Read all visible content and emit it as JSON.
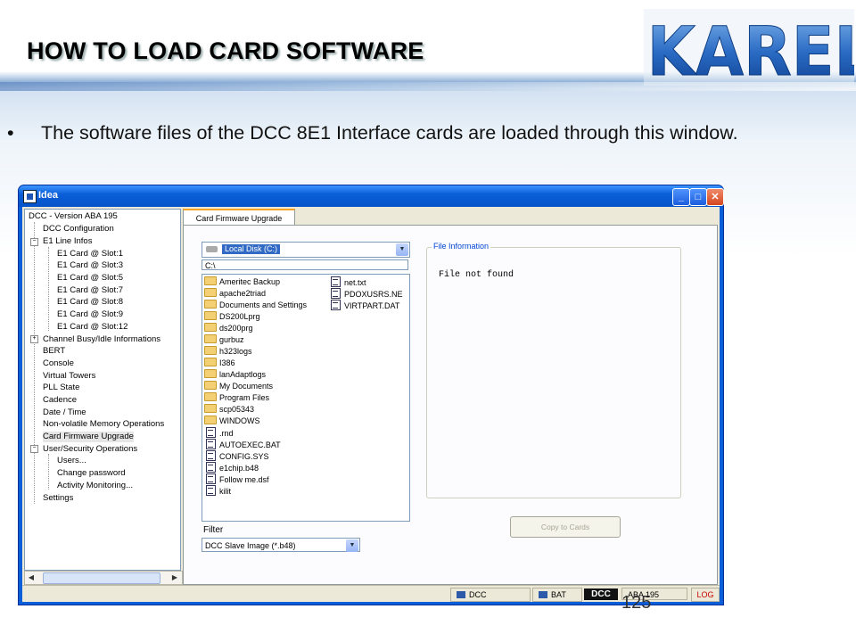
{
  "slide": {
    "title": "HOW TO LOAD CARD SOFTWARE",
    "logo_text": "KAREL",
    "bullet_marker": "•",
    "bullet": "The software files of the DCC 8E1 Interface cards are loaded through this window.",
    "page_number": "125"
  },
  "window": {
    "title": "Idea",
    "minimize": "_",
    "maximize": "□",
    "close": "✕",
    "tree": {
      "root": "DCC - Version ABA 195",
      "items": [
        "DCC Configuration",
        "E1 Line Infos",
        "E1 Card @ Slot:1",
        "E1 Card @ Slot:3",
        "E1 Card @ Slot:5",
        "E1 Card @ Slot:7",
        "E1 Card @ Slot:8",
        "E1 Card @ Slot:9",
        "E1 Card @ Slot:12",
        "Channel Busy/Idle Informations",
        "BERT",
        "Console",
        "Virtual Towers",
        "PLL State",
        "Cadence",
        "Date / Time",
        "Non-volatile Memory Operations",
        "Card Firmware Upgrade",
        "User/Security Operations",
        "Users...",
        "Change password",
        "Activity Monitoring...",
        "Settings"
      ]
    },
    "tab": "Card Firmware Upgrade",
    "drive": "Local Disk (C:)",
    "path": "C:\\",
    "files_col1": [
      "Ameritec Backup",
      "apache2triad",
      "Documents and Settings",
      "DS200Lprg",
      "ds200prg",
      "gurbuz",
      "h323logs",
      "I386",
      "lanAdaptlogs",
      "My Documents",
      "Program Files",
      "scp05343",
      "WINDOWS",
      ".rnd",
      "AUTOEXEC.BAT",
      "CONFIG.SYS",
      "e1chip.b48",
      "Follow me.dsf",
      "kilit"
    ],
    "files_col2": [
      "net.txt",
      "PDOXUSRS.NE",
      "VIRTPART.DAT"
    ],
    "filter_label": "Filter",
    "filter_value": "DCC Slave Image (*.b48)",
    "file_info_label": "File Information",
    "file_info_text": "File not found",
    "copy_button": "Copy to Cards",
    "status": {
      "dcc": "DCC",
      "bat": "BAT",
      "badge": "DCC",
      "version": "ABA 195",
      "log": "LOG"
    }
  },
  "colors": {
    "titlebar": "#0a5fd8",
    "selection": "#316ac5",
    "log": "#cc0000"
  }
}
